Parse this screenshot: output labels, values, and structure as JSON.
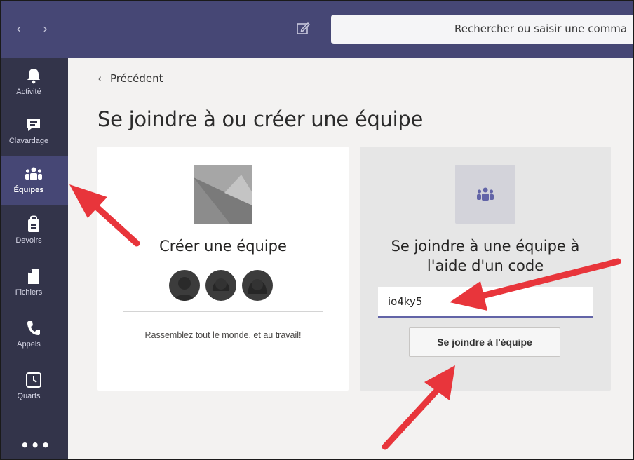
{
  "topbar": {
    "back_glyph": "‹",
    "forward_glyph": "›",
    "compose_icon": "compose-icon",
    "search_placeholder": "Rechercher ou saisir une comma"
  },
  "rail": {
    "items": [
      {
        "label": "Activité",
        "icon": "bell-icon"
      },
      {
        "label": "Clavardage",
        "icon": "chat-icon"
      },
      {
        "label": "Équipes",
        "icon": "teams-icon",
        "active": true
      },
      {
        "label": "Devoirs",
        "icon": "assignments-icon"
      },
      {
        "label": "Fichiers",
        "icon": "file-icon"
      },
      {
        "label": "Appels",
        "icon": "phone-icon"
      },
      {
        "label": "Quarts",
        "icon": "clock-icon"
      }
    ],
    "more": "•••"
  },
  "main": {
    "back_label": "Précédent",
    "back_glyph": "‹",
    "title": "Se joindre à ou créer une équipe",
    "create_card": {
      "title": "Créer une équipe",
      "description": "Rassemblez tout le monde, et au travail!"
    },
    "join_card": {
      "title": "Se joindre à une équipe à l'aide d'un code",
      "code_value": "io4ky5",
      "button_label": "Se joindre à l'équipe"
    }
  },
  "colors": {
    "topbar": "#464775",
    "rail": "#33344a",
    "rail_active": "#464775",
    "accent": "#6264a7",
    "annotation_arrow": "#e8353b"
  }
}
